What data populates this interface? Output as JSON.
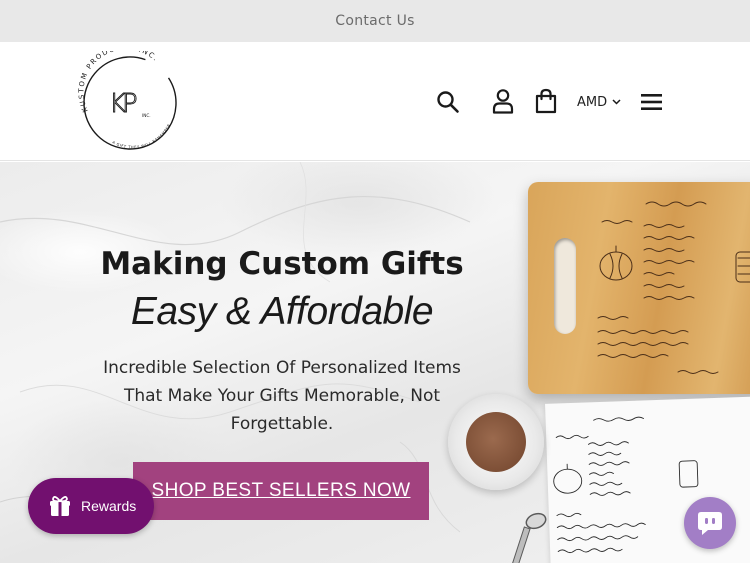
{
  "announcement": {
    "text": "Contact Us"
  },
  "header": {
    "logo": {
      "icon": "kp-monogram-logo",
      "arc_text": "KUSTOM PRODUCTS INC.",
      "monogram": "KP",
      "monogram_suffix": "INC.",
      "tagline": "A GIFT THEY WILL REMEMBER"
    },
    "icons": {
      "search": "search-icon",
      "account": "user-icon",
      "cart": "shopping-bag-icon",
      "menu": "hamburger-menu-icon"
    },
    "currency": {
      "selected": "AMD",
      "icon": "chevron-down-icon"
    }
  },
  "hero": {
    "title": "Making Custom Gifts",
    "subtitle": "Easy & Affordable",
    "text": "Incredible Selection Of Personalized Items That Make Your Gifts Memorable, Not Forgettable.",
    "cta_label": "SHOP BEST SELLERS NOW",
    "cta_color": "#a2427f"
  },
  "widgets": {
    "rewards_label": "Rewards",
    "rewards_icon": "gift-icon",
    "rewards_color": "#72106f",
    "chat_icon": "chat-bubble-icon",
    "chat_color": "#a27ec6"
  }
}
